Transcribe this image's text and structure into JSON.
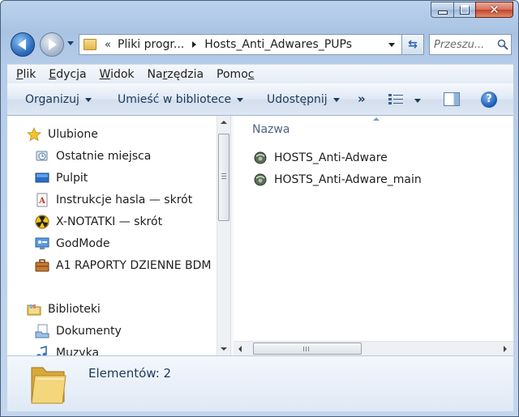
{
  "window": {
    "minimize_icon": "minimize-icon",
    "maximize_icon": "maximize-icon",
    "close_icon": "close-icon"
  },
  "navigation": {
    "back_icon": "back-arrow-icon",
    "forward_icon": "forward-arrow-icon"
  },
  "address": {
    "overflow": "«",
    "segments": [
      "Pliki progr...",
      "Hosts_Anti_Adwares_PUPs"
    ]
  },
  "search": {
    "placeholder": "Przeszu..."
  },
  "menu": {
    "items": [
      {
        "label_before": "",
        "mnemonic": "P",
        "label_after": "lik"
      },
      {
        "label_before": "",
        "mnemonic": "E",
        "label_after": "dycja"
      },
      {
        "label_before": "",
        "mnemonic": "W",
        "label_after": "idok"
      },
      {
        "label_before": "Na",
        "mnemonic": "r",
        "label_after": "zędzia"
      },
      {
        "label_before": "Pomo",
        "mnemonic": "c",
        "label_after": ""
      }
    ]
  },
  "toolbar": {
    "organize": "Organizuj",
    "library": "Umieść w bibliotece",
    "share": "Udostępnij",
    "overflow": "»",
    "help": "?"
  },
  "navpane": {
    "favorites": "Ulubione",
    "items": [
      {
        "label": "Ostatnie miejsca",
        "icon": "recent-places-icon"
      },
      {
        "label": "Pulpit",
        "icon": "desktop-icon"
      },
      {
        "label": "Instrukcje hasla — skrót",
        "icon": "document-shortcut-icon"
      },
      {
        "label": "X-NOTATKI — skrót",
        "icon": "radiation-icon"
      },
      {
        "label": "GodMode",
        "icon": "control-panel-icon"
      },
      {
        "label": "A1 RAPORTY  DZIENNE BDM",
        "icon": "briefcase-icon"
      }
    ],
    "libraries": "Biblioteki",
    "library_items": [
      {
        "label": "Dokumenty",
        "icon": "documents-library-icon"
      },
      {
        "label": "Muzyka",
        "icon": "music-library-icon"
      }
    ]
  },
  "content": {
    "column_header": "Nazwa",
    "files": [
      {
        "name": "HOSTS_Anti-Adware",
        "icon": "batch-file-icon"
      },
      {
        "name": "HOSTS_Anti-Adware_main",
        "icon": "batch-file-icon"
      }
    ]
  },
  "details": {
    "item_count": "Elementów: 2",
    "icon": "folder-icon"
  },
  "colors": {
    "frame": "#a9c3e3",
    "accent_text": "#1e395b",
    "header_text": "#4b6386"
  }
}
